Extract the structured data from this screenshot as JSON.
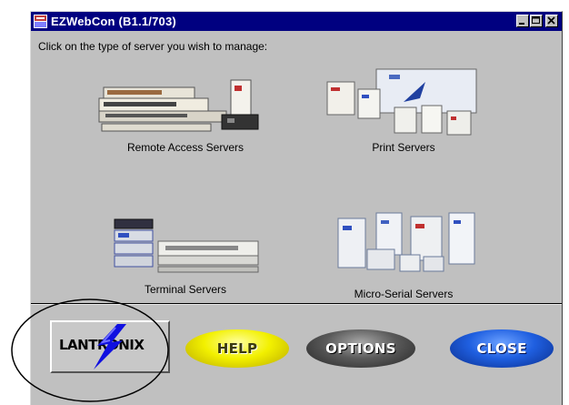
{
  "window": {
    "title": "EZWebCon (B1.1/703)",
    "icon": "ezwebcon-app-icon",
    "controls": [
      "minimize-icon",
      "maximize-icon",
      "close-icon"
    ]
  },
  "instruction": "Click on the type of server you wish to manage:",
  "servers": [
    {
      "label": "Remote Access Servers",
      "icon": "remote-access-servers-image"
    },
    {
      "label": "Print Servers",
      "icon": "print-servers-image"
    },
    {
      "label": "Terminal Servers",
      "icon": "terminal-servers-image"
    },
    {
      "label": "Micro-Serial Servers",
      "icon": "micro-serial-servers-image"
    }
  ],
  "buttons": {
    "lantronix": "LANTRONIX",
    "help": "HELP",
    "options": "OPTIONS",
    "close": "CLOSE"
  },
  "colors": {
    "titlebar": "#000080",
    "window_bg": "#c0c0c0",
    "help": "#f2f000",
    "options": "#5a5a5a",
    "close": "#1f5fe0"
  }
}
